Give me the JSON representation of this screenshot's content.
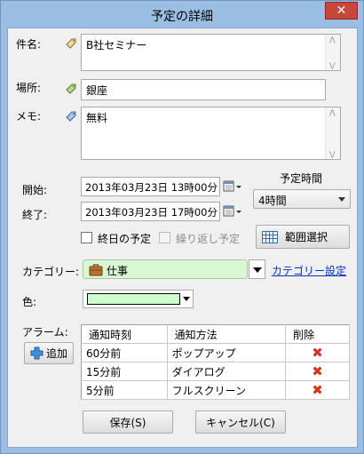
{
  "window": {
    "title": "予定の詳細",
    "close_glyph": "✕"
  },
  "subject": {
    "label": "件名:",
    "value": "B社セミナー"
  },
  "location": {
    "label": "場所:",
    "value": "銀座"
  },
  "memo": {
    "label": "メモ:",
    "value": "無料"
  },
  "start": {
    "label": "開始:",
    "value": "2013年03月23日 13時00分"
  },
  "end": {
    "label": "終了:",
    "value": "2013年03月23日 17時00分"
  },
  "duration": {
    "label": "予定時間",
    "selected": "4時間"
  },
  "all_day": {
    "label": "終日の予定",
    "checked": false
  },
  "repeat": {
    "label": "繰り返し予定",
    "checked": false,
    "enabled": false
  },
  "range_select": {
    "label": "範囲選択"
  },
  "category": {
    "label": "カテゴリー:",
    "value": "仕事",
    "link": "カテゴリー設定",
    "icon": "briefcase-icon"
  },
  "color": {
    "label": "色:",
    "value": "#ccffcc"
  },
  "alarm": {
    "label": "アラーム:",
    "add_label": "追加",
    "columns": [
      "通知時刻",
      "通知方法",
      "削除"
    ],
    "rows": [
      {
        "time": "60分前",
        "method": "ポップアップ"
      },
      {
        "time": "15分前",
        "method": "ダイアログ"
      },
      {
        "time": "5分前",
        "method": "フルスクリーン"
      }
    ]
  },
  "buttons": {
    "save": "保存(S)",
    "cancel": "キャンセル(C)"
  },
  "colors": {
    "title_bar": "#9bbfe3",
    "close_button": "#c7473b",
    "link": "#0033cc",
    "delete": "#d8331f",
    "category_bg": "#d9f7d2"
  }
}
